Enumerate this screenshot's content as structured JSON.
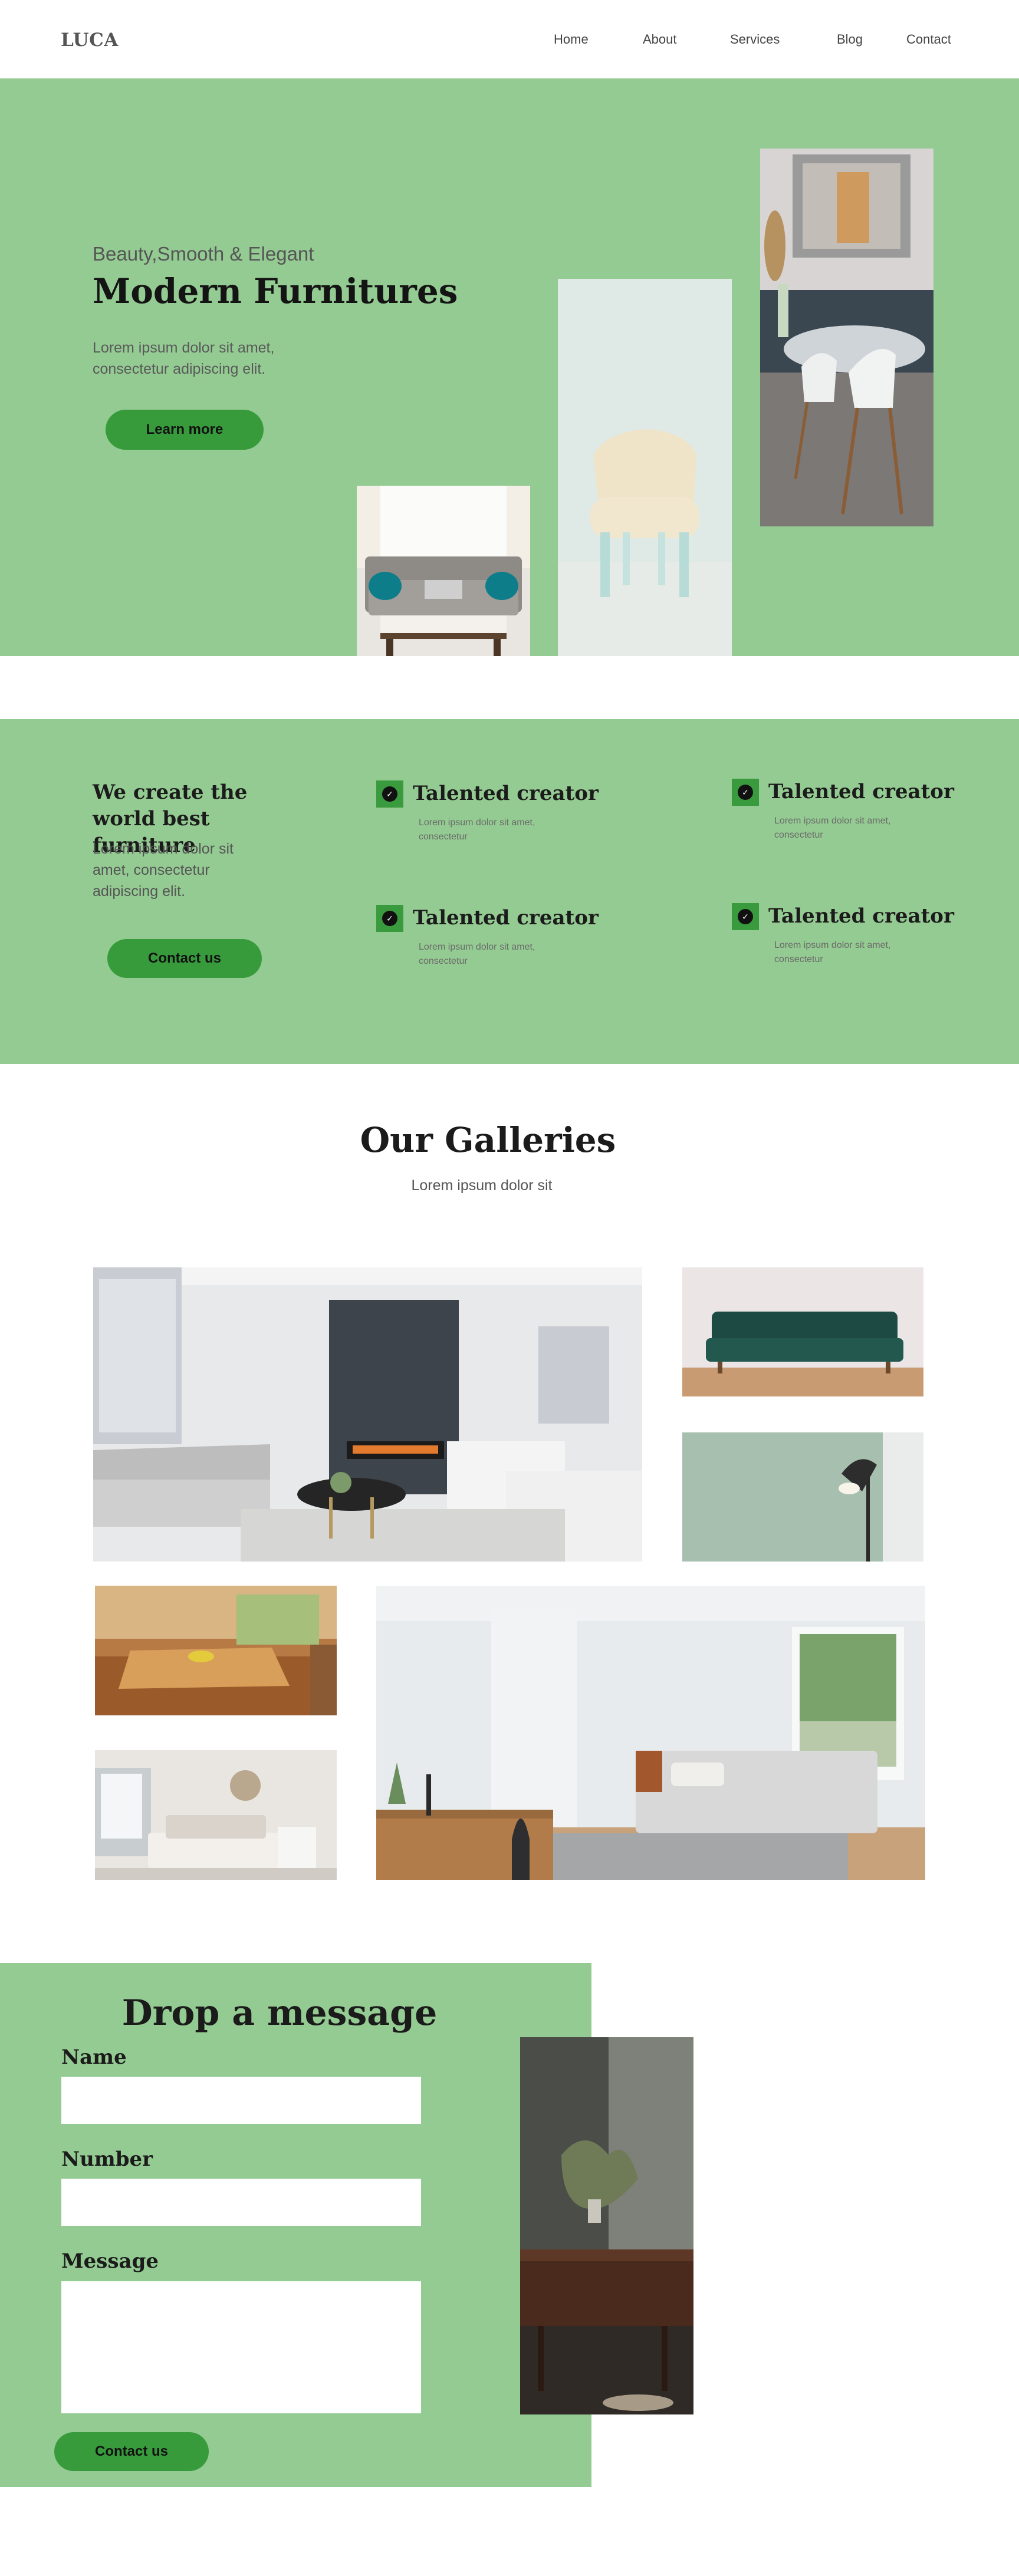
{
  "header": {
    "logo": "LUCA",
    "nav": [
      "Home",
      "About",
      "Services",
      "Blog",
      "Contact"
    ]
  },
  "hero": {
    "subtitle": "Beauty,Smooth & Elegant",
    "title": "Modern Furnitures",
    "body": "Lorem ipsum dolor sit amet, consectetur adipiscing elit.",
    "button": "Learn more"
  },
  "features": {
    "heading": "We create the world best furniture",
    "text": "Lorem ipsum dolor sit amet, consectetur adipiscing elit.",
    "button": "Contact us",
    "items": [
      {
        "title": "Talented creator",
        "desc": "Lorem ipsum dolor sit amet, consectetur"
      },
      {
        "title": "Talented creator",
        "desc": "Lorem ipsum dolor sit amet, consectetur"
      },
      {
        "title": "Talented creator",
        "desc": "Lorem ipsum dolor sit amet, consectetur"
      },
      {
        "title": "Talented creator",
        "desc": "Lorem ipsum dolor sit amet, consectetur"
      }
    ]
  },
  "galleries": {
    "title": "Our Galleries",
    "subtitle": "Lorem ipsum dolor sit"
  },
  "contact": {
    "title": "Drop a message",
    "name_label": "Name",
    "number_label": "Number",
    "message_label": "Message",
    "button": "Contact us"
  },
  "icons": {
    "feature_icon": "check-circle-icon"
  },
  "colors": {
    "section_green": "#94cb92",
    "button_green": "#379b3c",
    "text_dark": "#141414"
  }
}
